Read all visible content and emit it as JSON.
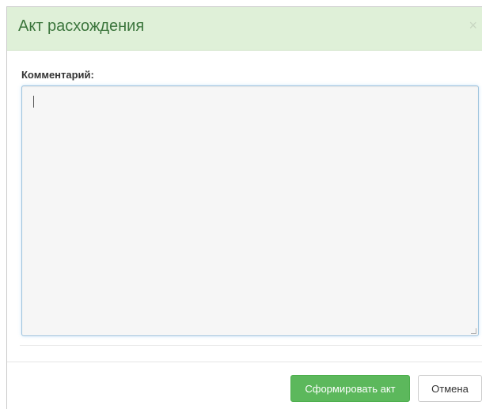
{
  "dialog": {
    "title": "Акт расхождения",
    "close_label": "×"
  },
  "form": {
    "comment_label": "Комментарий:",
    "comment_value": ""
  },
  "footer": {
    "submit_label": "Сформировать акт",
    "cancel_label": "Отмена"
  },
  "colors": {
    "header_bg": "#dff0d8",
    "header_text": "#3c763d",
    "primary_button": "#5cb85c"
  }
}
